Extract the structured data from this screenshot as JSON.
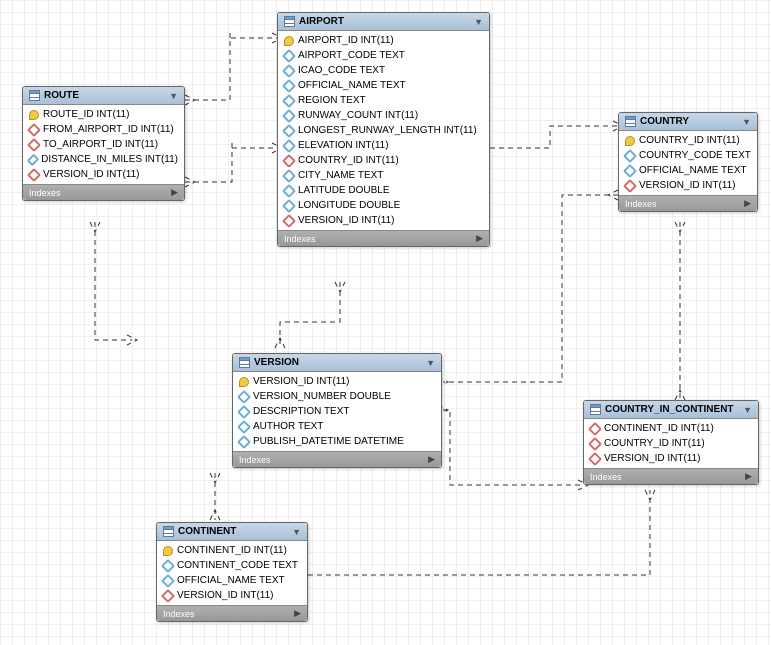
{
  "route": {
    "title": "ROUTE",
    "cols": [
      {
        "icon": "key",
        "label": "ROUTE_ID INT(11)"
      },
      {
        "icon": "red",
        "label": "FROM_AIRPORT_ID INT(11)"
      },
      {
        "icon": "red",
        "label": "TO_AIRPORT_ID INT(11)"
      },
      {
        "icon": "blue",
        "label": "DISTANCE_IN_MILES INT(11)"
      },
      {
        "icon": "red",
        "label": "VERSION_ID INT(11)"
      }
    ],
    "footer": "Indexes"
  },
  "airport": {
    "title": "AIRPORT",
    "cols": [
      {
        "icon": "key",
        "label": "AIRPORT_ID INT(11)"
      },
      {
        "icon": "blue",
        "label": "AIRPORT_CODE TEXT"
      },
      {
        "icon": "blue",
        "label": "ICAO_CODE TEXT"
      },
      {
        "icon": "blue",
        "label": "OFFICIAL_NAME TEXT"
      },
      {
        "icon": "blue",
        "label": "REGION TEXT"
      },
      {
        "icon": "blue",
        "label": "RUNWAY_COUNT INT(11)"
      },
      {
        "icon": "blue",
        "label": "LONGEST_RUNWAY_LENGTH INT(11)"
      },
      {
        "icon": "blue",
        "label": "ELEVATION INT(11)"
      },
      {
        "icon": "red",
        "label": "COUNTRY_ID INT(11)"
      },
      {
        "icon": "blue",
        "label": "CITY_NAME TEXT"
      },
      {
        "icon": "blue",
        "label": "LATITUDE DOUBLE"
      },
      {
        "icon": "blue",
        "label": "LONGITUDE DOUBLE"
      },
      {
        "icon": "red",
        "label": "VERSION_ID INT(11)"
      }
    ],
    "footer": "Indexes"
  },
  "country": {
    "title": "COUNTRY",
    "cols": [
      {
        "icon": "key",
        "label": "COUNTRY_ID INT(11)"
      },
      {
        "icon": "blue",
        "label": "COUNTRY_CODE TEXT"
      },
      {
        "icon": "blue",
        "label": "OFFICIAL_NAME TEXT"
      },
      {
        "icon": "red",
        "label": "VERSION_ID INT(11)"
      }
    ],
    "footer": "Indexes"
  },
  "version": {
    "title": "VERSION",
    "cols": [
      {
        "icon": "key",
        "label": "VERSION_ID INT(11)"
      },
      {
        "icon": "blue",
        "label": "VERSION_NUMBER DOUBLE"
      },
      {
        "icon": "blue",
        "label": "DESCRIPTION TEXT"
      },
      {
        "icon": "blue",
        "label": "AUTHOR TEXT"
      },
      {
        "icon": "blue",
        "label": "PUBLISH_DATETIME DATETIME"
      }
    ],
    "footer": "Indexes"
  },
  "country_in_continent": {
    "title": "COUNTRY_IN_CONTINENT",
    "cols": [
      {
        "icon": "red",
        "label": "CONTINENT_ID INT(11)"
      },
      {
        "icon": "red",
        "label": "COUNTRY_ID INT(11)"
      },
      {
        "icon": "red",
        "label": "VERSION_ID INT(11)"
      }
    ],
    "footer": "Indexes"
  },
  "continent": {
    "title": "CONTINENT",
    "cols": [
      {
        "icon": "key",
        "label": "CONTINENT_ID INT(11)"
      },
      {
        "icon": "blue",
        "label": "CONTINENT_CODE TEXT"
      },
      {
        "icon": "blue",
        "label": "OFFICIAL_NAME TEXT"
      },
      {
        "icon": "red",
        "label": "VERSION_ID INT(11)"
      }
    ],
    "footer": "Indexes"
  }
}
